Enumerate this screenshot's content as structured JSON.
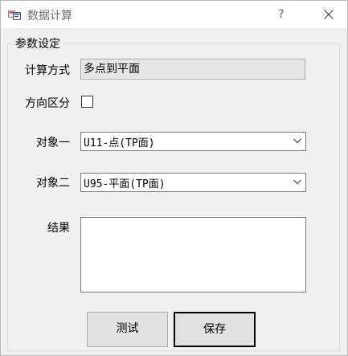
{
  "window": {
    "title": "数据计算",
    "help": "?"
  },
  "group": {
    "title": "参数设定"
  },
  "fields": {
    "calc_method": {
      "label": "计算方式",
      "value": "多点到平面"
    },
    "direction": {
      "label": "方向区分",
      "checked": false
    },
    "object1": {
      "label": "对象一",
      "value": "U11-点(TP面)"
    },
    "object2": {
      "label": "对象二",
      "value": "U95-平面(TP面)"
    },
    "result": {
      "label": "结果",
      "value": ""
    }
  },
  "buttons": {
    "test": "测试",
    "save": "保存"
  },
  "icons": {
    "app": "app-window-icon",
    "close": "close-icon",
    "dropdown": "chevron-down-icon"
  }
}
